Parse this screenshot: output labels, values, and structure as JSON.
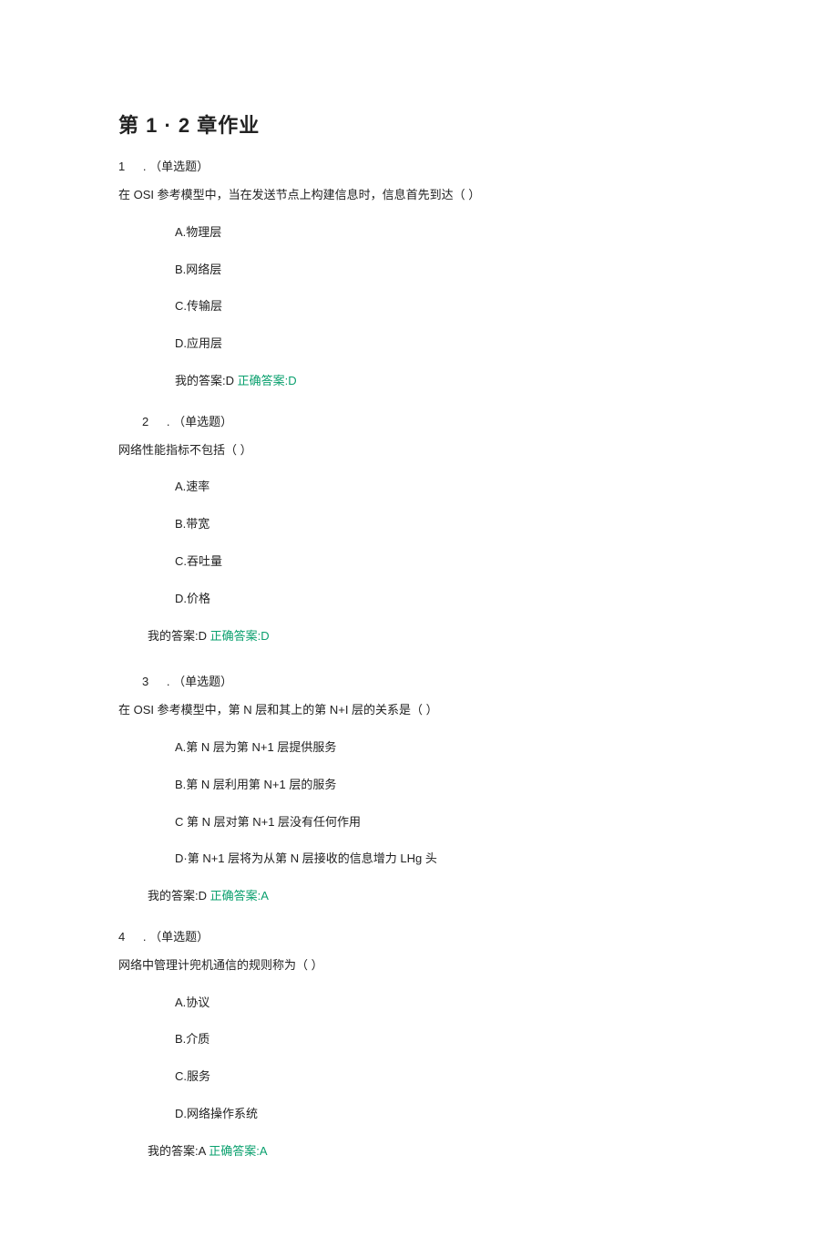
{
  "title": "第 1 · 2 章作业",
  "questions": [
    {
      "num": "1",
      "type": "（单选题）",
      "stem": "在 OSI 参考模型中，当在发送节点上构建信息时，信息首先到达（ ）",
      "options": [
        "A.物理层",
        "B.网络层",
        "C.传输层",
        "D.应用层"
      ],
      "my_answer_label": "我的答案:D",
      "correct_label": "正确答案:D"
    },
    {
      "num": "2",
      "type": "（单选题）",
      "stem": "网络性能指标不包括（ ）",
      "options": [
        "A.速率",
        "B.带宽",
        "C.吞吐量",
        "D.价格"
      ],
      "my_answer_label": "我的答案:D",
      "correct_label": "正确答案:D"
    },
    {
      "num": "3",
      "type": "（单选题）",
      "stem": "在 OSI 参考模型中，第 N 层和其上的第 N+I 层的关系是（ ）",
      "options": [
        "A.第 N 层为第 N+1 层提供服务",
        "B.第 N 层利用第 N+1 层的服务",
        "C 第 N 层对第 N+1 层没有任何作用",
        "D·第 N+1 层将为从第 N 层接收的信息增力 LHg 头"
      ],
      "my_answer_label": "我的答案:D",
      "correct_label": "正确答案:A"
    },
    {
      "num": "4",
      "type": "（单选题）",
      "stem": "网络中管理计兜机通信的规则称为（ ）",
      "options": [
        "A.协议",
        "B.介质",
        "C.服务",
        "D.网络操作系统"
      ],
      "my_answer_label": "我的答案:A",
      "correct_label": "正确答案:A"
    }
  ]
}
